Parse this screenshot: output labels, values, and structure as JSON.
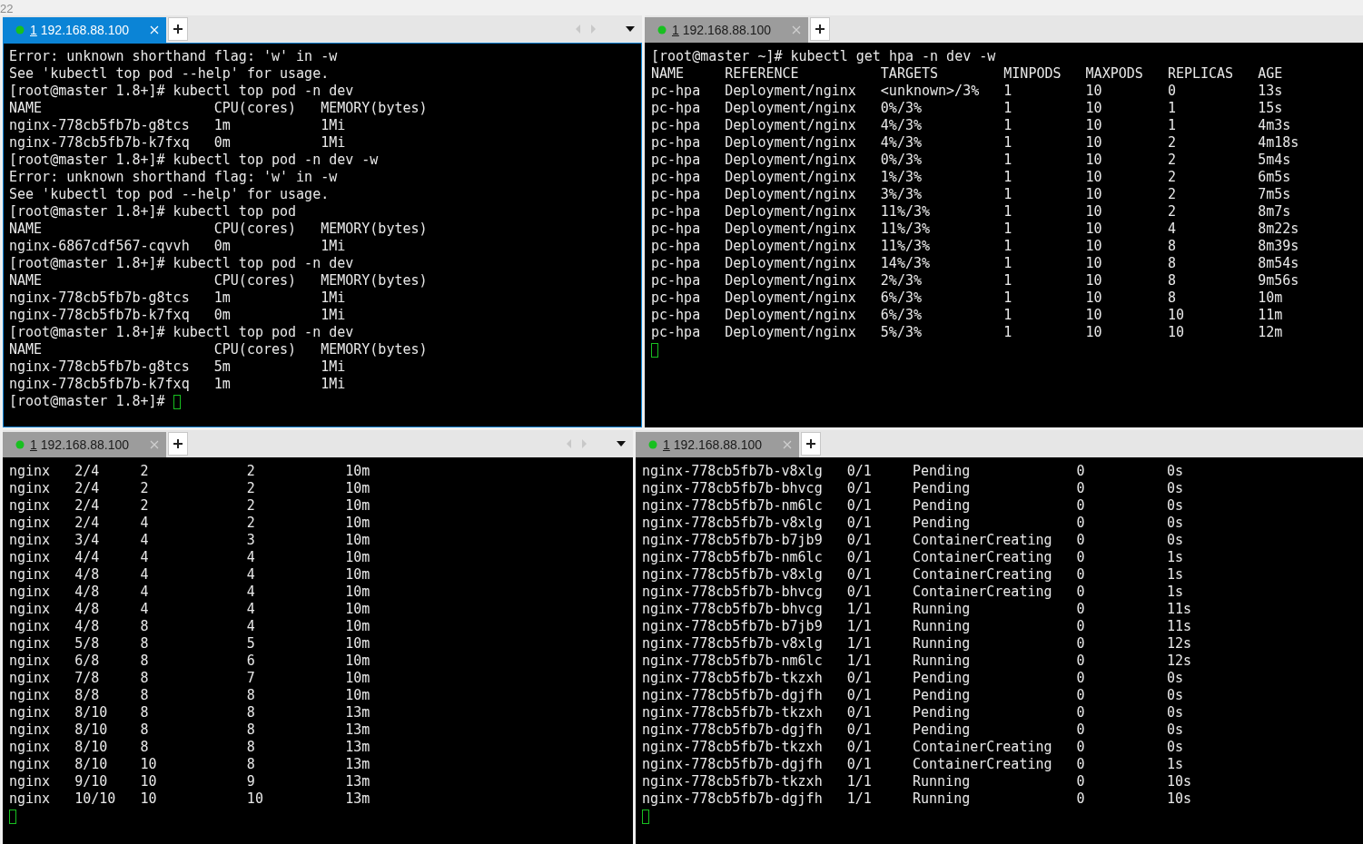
{
  "corner_text": "22",
  "panes": [
    {
      "tab": {
        "number": "1",
        "host": "192.168.88.100",
        "selected": true
      },
      "tab_scroll": true,
      "cursor": true,
      "lines": [
        {
          "kind": "text",
          "text": "Error: unknown shorthand flag: 'w' in -w"
        },
        {
          "kind": "text",
          "text": "See 'kubectl top pod --help' for usage."
        },
        {
          "kind": "text",
          "text": "[root@master 1.8+]# kubectl top pod -n dev"
        },
        {
          "kind": "row",
          "cells": [
            "NAME",
            "CPU(cores)",
            "MEMORY(bytes)"
          ]
        },
        {
          "kind": "row",
          "cells": [
            "nginx-778cb5fb7b-g8tcs",
            "1m",
            "1Mi"
          ]
        },
        {
          "kind": "row",
          "cells": [
            "nginx-778cb5fb7b-k7fxq",
            "0m",
            "1Mi"
          ]
        },
        {
          "kind": "text",
          "text": "[root@master 1.8+]# kubectl top pod -n dev -w"
        },
        {
          "kind": "text",
          "text": "Error: unknown shorthand flag: 'w' in -w"
        },
        {
          "kind": "text",
          "text": "See 'kubectl top pod --help' for usage."
        },
        {
          "kind": "text",
          "text": "[root@master 1.8+]# kubectl top pod"
        },
        {
          "kind": "row",
          "cells": [
            "NAME",
            "CPU(cores)",
            "MEMORY(bytes)"
          ]
        },
        {
          "kind": "row",
          "cells": [
            "nginx-6867cdf567-cqvvh",
            "0m",
            "1Mi"
          ]
        },
        {
          "kind": "text",
          "text": "[root@master 1.8+]# kubectl top pod -n dev"
        },
        {
          "kind": "row",
          "cells": [
            "NAME",
            "CPU(cores)",
            "MEMORY(bytes)"
          ]
        },
        {
          "kind": "row",
          "cells": [
            "nginx-778cb5fb7b-g8tcs",
            "1m",
            "1Mi"
          ]
        },
        {
          "kind": "row",
          "cells": [
            "nginx-778cb5fb7b-k7fxq",
            "0m",
            "1Mi"
          ]
        },
        {
          "kind": "text",
          "text": "[root@master 1.8+]# kubectl top pod -n dev"
        },
        {
          "kind": "row",
          "cells": [
            "NAME",
            "CPU(cores)",
            "MEMORY(bytes)"
          ]
        },
        {
          "kind": "row",
          "cells": [
            "nginx-778cb5fb7b-g8tcs",
            "5m",
            "1Mi"
          ]
        },
        {
          "kind": "row",
          "cells": [
            "nginx-778cb5fb7b-k7fxq",
            "1m",
            "1Mi"
          ]
        },
        {
          "kind": "text",
          "text": "[root@master 1.8+]#"
        }
      ]
    },
    {
      "tab": {
        "number": "1",
        "host": "192.168.88.100",
        "selected": false
      },
      "tab_scroll": false,
      "cursor": true,
      "lines": [
        {
          "kind": "text",
          "text": "[root@master ~]# kubectl get hpa -n dev -w"
        },
        {
          "kind": "row",
          "cells": [
            "NAME",
            "REFERENCE",
            "TARGETS",
            "MINPODS",
            "MAXPODS",
            "REPLICAS",
            "AGE"
          ]
        },
        {
          "kind": "row",
          "cells": [
            "pc-hpa",
            "Deployment/nginx",
            "<unknown>/3%",
            "1",
            "10",
            "0",
            "13s"
          ]
        },
        {
          "kind": "row",
          "cells": [
            "pc-hpa",
            "Deployment/nginx",
            "0%/3%",
            "1",
            "10",
            "1",
            "15s"
          ]
        },
        {
          "kind": "row",
          "cells": [
            "pc-hpa",
            "Deployment/nginx",
            "4%/3%",
            "1",
            "10",
            "1",
            "4m3s"
          ]
        },
        {
          "kind": "row",
          "cells": [
            "pc-hpa",
            "Deployment/nginx",
            "4%/3%",
            "1",
            "10",
            "2",
            "4m18s"
          ]
        },
        {
          "kind": "row",
          "cells": [
            "pc-hpa",
            "Deployment/nginx",
            "0%/3%",
            "1",
            "10",
            "2",
            "5m4s"
          ]
        },
        {
          "kind": "row",
          "cells": [
            "pc-hpa",
            "Deployment/nginx",
            "1%/3%",
            "1",
            "10",
            "2",
            "6m5s"
          ]
        },
        {
          "kind": "row",
          "cells": [
            "pc-hpa",
            "Deployment/nginx",
            "3%/3%",
            "1",
            "10",
            "2",
            "7m5s"
          ]
        },
        {
          "kind": "row",
          "cells": [
            "pc-hpa",
            "Deployment/nginx",
            "11%/3%",
            "1",
            "10",
            "2",
            "8m7s"
          ]
        },
        {
          "kind": "row",
          "cells": [
            "pc-hpa",
            "Deployment/nginx",
            "11%/3%",
            "1",
            "10",
            "4",
            "8m22s"
          ]
        },
        {
          "kind": "row",
          "cells": [
            "pc-hpa",
            "Deployment/nginx",
            "11%/3%",
            "1",
            "10",
            "8",
            "8m39s"
          ]
        },
        {
          "kind": "row",
          "cells": [
            "pc-hpa",
            "Deployment/nginx",
            "14%/3%",
            "1",
            "10",
            "8",
            "8m54s"
          ]
        },
        {
          "kind": "row",
          "cells": [
            "pc-hpa",
            "Deployment/nginx",
            "2%/3%",
            "1",
            "10",
            "8",
            "9m56s"
          ]
        },
        {
          "kind": "row",
          "cells": [
            "pc-hpa",
            "Deployment/nginx",
            "6%/3%",
            "1",
            "10",
            "8",
            "10m"
          ]
        },
        {
          "kind": "row",
          "cells": [
            "pc-hpa",
            "Deployment/nginx",
            "6%/3%",
            "1",
            "10",
            "10",
            "11m"
          ]
        },
        {
          "kind": "row",
          "cells": [
            "pc-hpa",
            "Deployment/nginx",
            "5%/3%",
            "1",
            "10",
            "10",
            "12m"
          ]
        }
      ]
    },
    {
      "tab": {
        "number": "1",
        "host": "192.168.88.100",
        "selected": false
      },
      "tab_scroll": true,
      "cursor": true,
      "lines": [
        {
          "kind": "row",
          "cells": [
            "nginx",
            "2/4",
            "2",
            "2",
            "10m"
          ]
        },
        {
          "kind": "row",
          "cells": [
            "nginx",
            "2/4",
            "2",
            "2",
            "10m"
          ]
        },
        {
          "kind": "row",
          "cells": [
            "nginx",
            "2/4",
            "2",
            "2",
            "10m"
          ]
        },
        {
          "kind": "row",
          "cells": [
            "nginx",
            "2/4",
            "4",
            "2",
            "10m"
          ]
        },
        {
          "kind": "row",
          "cells": [
            "nginx",
            "3/4",
            "4",
            "3",
            "10m"
          ]
        },
        {
          "kind": "row",
          "cells": [
            "nginx",
            "4/4",
            "4",
            "4",
            "10m"
          ]
        },
        {
          "kind": "row",
          "cells": [
            "nginx",
            "4/8",
            "4",
            "4",
            "10m"
          ]
        },
        {
          "kind": "row",
          "cells": [
            "nginx",
            "4/8",
            "4",
            "4",
            "10m"
          ]
        },
        {
          "kind": "row",
          "cells": [
            "nginx",
            "4/8",
            "4",
            "4",
            "10m"
          ]
        },
        {
          "kind": "row",
          "cells": [
            "nginx",
            "4/8",
            "8",
            "4",
            "10m"
          ]
        },
        {
          "kind": "row",
          "cells": [
            "nginx",
            "5/8",
            "8",
            "5",
            "10m"
          ]
        },
        {
          "kind": "row",
          "cells": [
            "nginx",
            "6/8",
            "8",
            "6",
            "10m"
          ]
        },
        {
          "kind": "row",
          "cells": [
            "nginx",
            "7/8",
            "8",
            "7",
            "10m"
          ]
        },
        {
          "kind": "row",
          "cells": [
            "nginx",
            "8/8",
            "8",
            "8",
            "10m"
          ]
        },
        {
          "kind": "row",
          "cells": [
            "nginx",
            "8/10",
            "8",
            "8",
            "13m"
          ]
        },
        {
          "kind": "row",
          "cells": [
            "nginx",
            "8/10",
            "8",
            "8",
            "13m"
          ]
        },
        {
          "kind": "row",
          "cells": [
            "nginx",
            "8/10",
            "8",
            "8",
            "13m"
          ]
        },
        {
          "kind": "row",
          "cells": [
            "nginx",
            "8/10",
            "10",
            "8",
            "13m"
          ]
        },
        {
          "kind": "row",
          "cells": [
            "nginx",
            "9/10",
            "10",
            "9",
            "13m"
          ]
        },
        {
          "kind": "row",
          "cells": [
            "nginx",
            "10/10",
            "10",
            "10",
            "13m"
          ]
        }
      ]
    },
    {
      "tab": {
        "number": "1",
        "host": "192.168.88.100",
        "selected": false
      },
      "tab_scroll": false,
      "cursor": true,
      "lines": [
        {
          "kind": "row",
          "cells": [
            "nginx-778cb5fb7b-v8xlg",
            "0/1",
            "Pending",
            "0",
            "0s"
          ]
        },
        {
          "kind": "row",
          "cells": [
            "nginx-778cb5fb7b-bhvcg",
            "0/1",
            "Pending",
            "0",
            "0s"
          ]
        },
        {
          "kind": "row",
          "cells": [
            "nginx-778cb5fb7b-nm6lc",
            "0/1",
            "Pending",
            "0",
            "0s"
          ]
        },
        {
          "kind": "row",
          "cells": [
            "nginx-778cb5fb7b-v8xlg",
            "0/1",
            "Pending",
            "0",
            "0s"
          ]
        },
        {
          "kind": "row",
          "cells": [
            "nginx-778cb5fb7b-b7jb9",
            "0/1",
            "ContainerCreating",
            "0",
            "0s"
          ]
        },
        {
          "kind": "row",
          "cells": [
            "nginx-778cb5fb7b-nm6lc",
            "0/1",
            "ContainerCreating",
            "0",
            "1s"
          ]
        },
        {
          "kind": "row",
          "cells": [
            "nginx-778cb5fb7b-v8xlg",
            "0/1",
            "ContainerCreating",
            "0",
            "1s"
          ]
        },
        {
          "kind": "row",
          "cells": [
            "nginx-778cb5fb7b-bhvcg",
            "0/1",
            "ContainerCreating",
            "0",
            "1s"
          ]
        },
        {
          "kind": "row",
          "cells": [
            "nginx-778cb5fb7b-bhvcg",
            "1/1",
            "Running",
            "0",
            "11s"
          ]
        },
        {
          "kind": "row",
          "cells": [
            "nginx-778cb5fb7b-b7jb9",
            "1/1",
            "Running",
            "0",
            "11s"
          ]
        },
        {
          "kind": "row",
          "cells": [
            "nginx-778cb5fb7b-v8xlg",
            "1/1",
            "Running",
            "0",
            "12s"
          ]
        },
        {
          "kind": "row",
          "cells": [
            "nginx-778cb5fb7b-nm6lc",
            "1/1",
            "Running",
            "0",
            "12s"
          ]
        },
        {
          "kind": "row",
          "cells": [
            "nginx-778cb5fb7b-tkzxh",
            "0/1",
            "Pending",
            "0",
            "0s"
          ]
        },
        {
          "kind": "row",
          "cells": [
            "nginx-778cb5fb7b-dgjfh",
            "0/1",
            "Pending",
            "0",
            "0s"
          ]
        },
        {
          "kind": "row",
          "cells": [
            "nginx-778cb5fb7b-tkzxh",
            "0/1",
            "Pending",
            "0",
            "0s"
          ]
        },
        {
          "kind": "row",
          "cells": [
            "nginx-778cb5fb7b-dgjfh",
            "0/1",
            "Pending",
            "0",
            "0s"
          ]
        },
        {
          "kind": "row",
          "cells": [
            "nginx-778cb5fb7b-tkzxh",
            "0/1",
            "ContainerCreating",
            "0",
            "0s"
          ]
        },
        {
          "kind": "row",
          "cells": [
            "nginx-778cb5fb7b-dgjfh",
            "0/1",
            "ContainerCreating",
            "0",
            "1s"
          ]
        },
        {
          "kind": "row",
          "cells": [
            "nginx-778cb5fb7b-tkzxh",
            "1/1",
            "Running",
            "0",
            "10s"
          ]
        },
        {
          "kind": "row",
          "cells": [
            "nginx-778cb5fb7b-dgjfh",
            "1/1",
            "Running",
            "0",
            "10s"
          ]
        }
      ]
    }
  ]
}
